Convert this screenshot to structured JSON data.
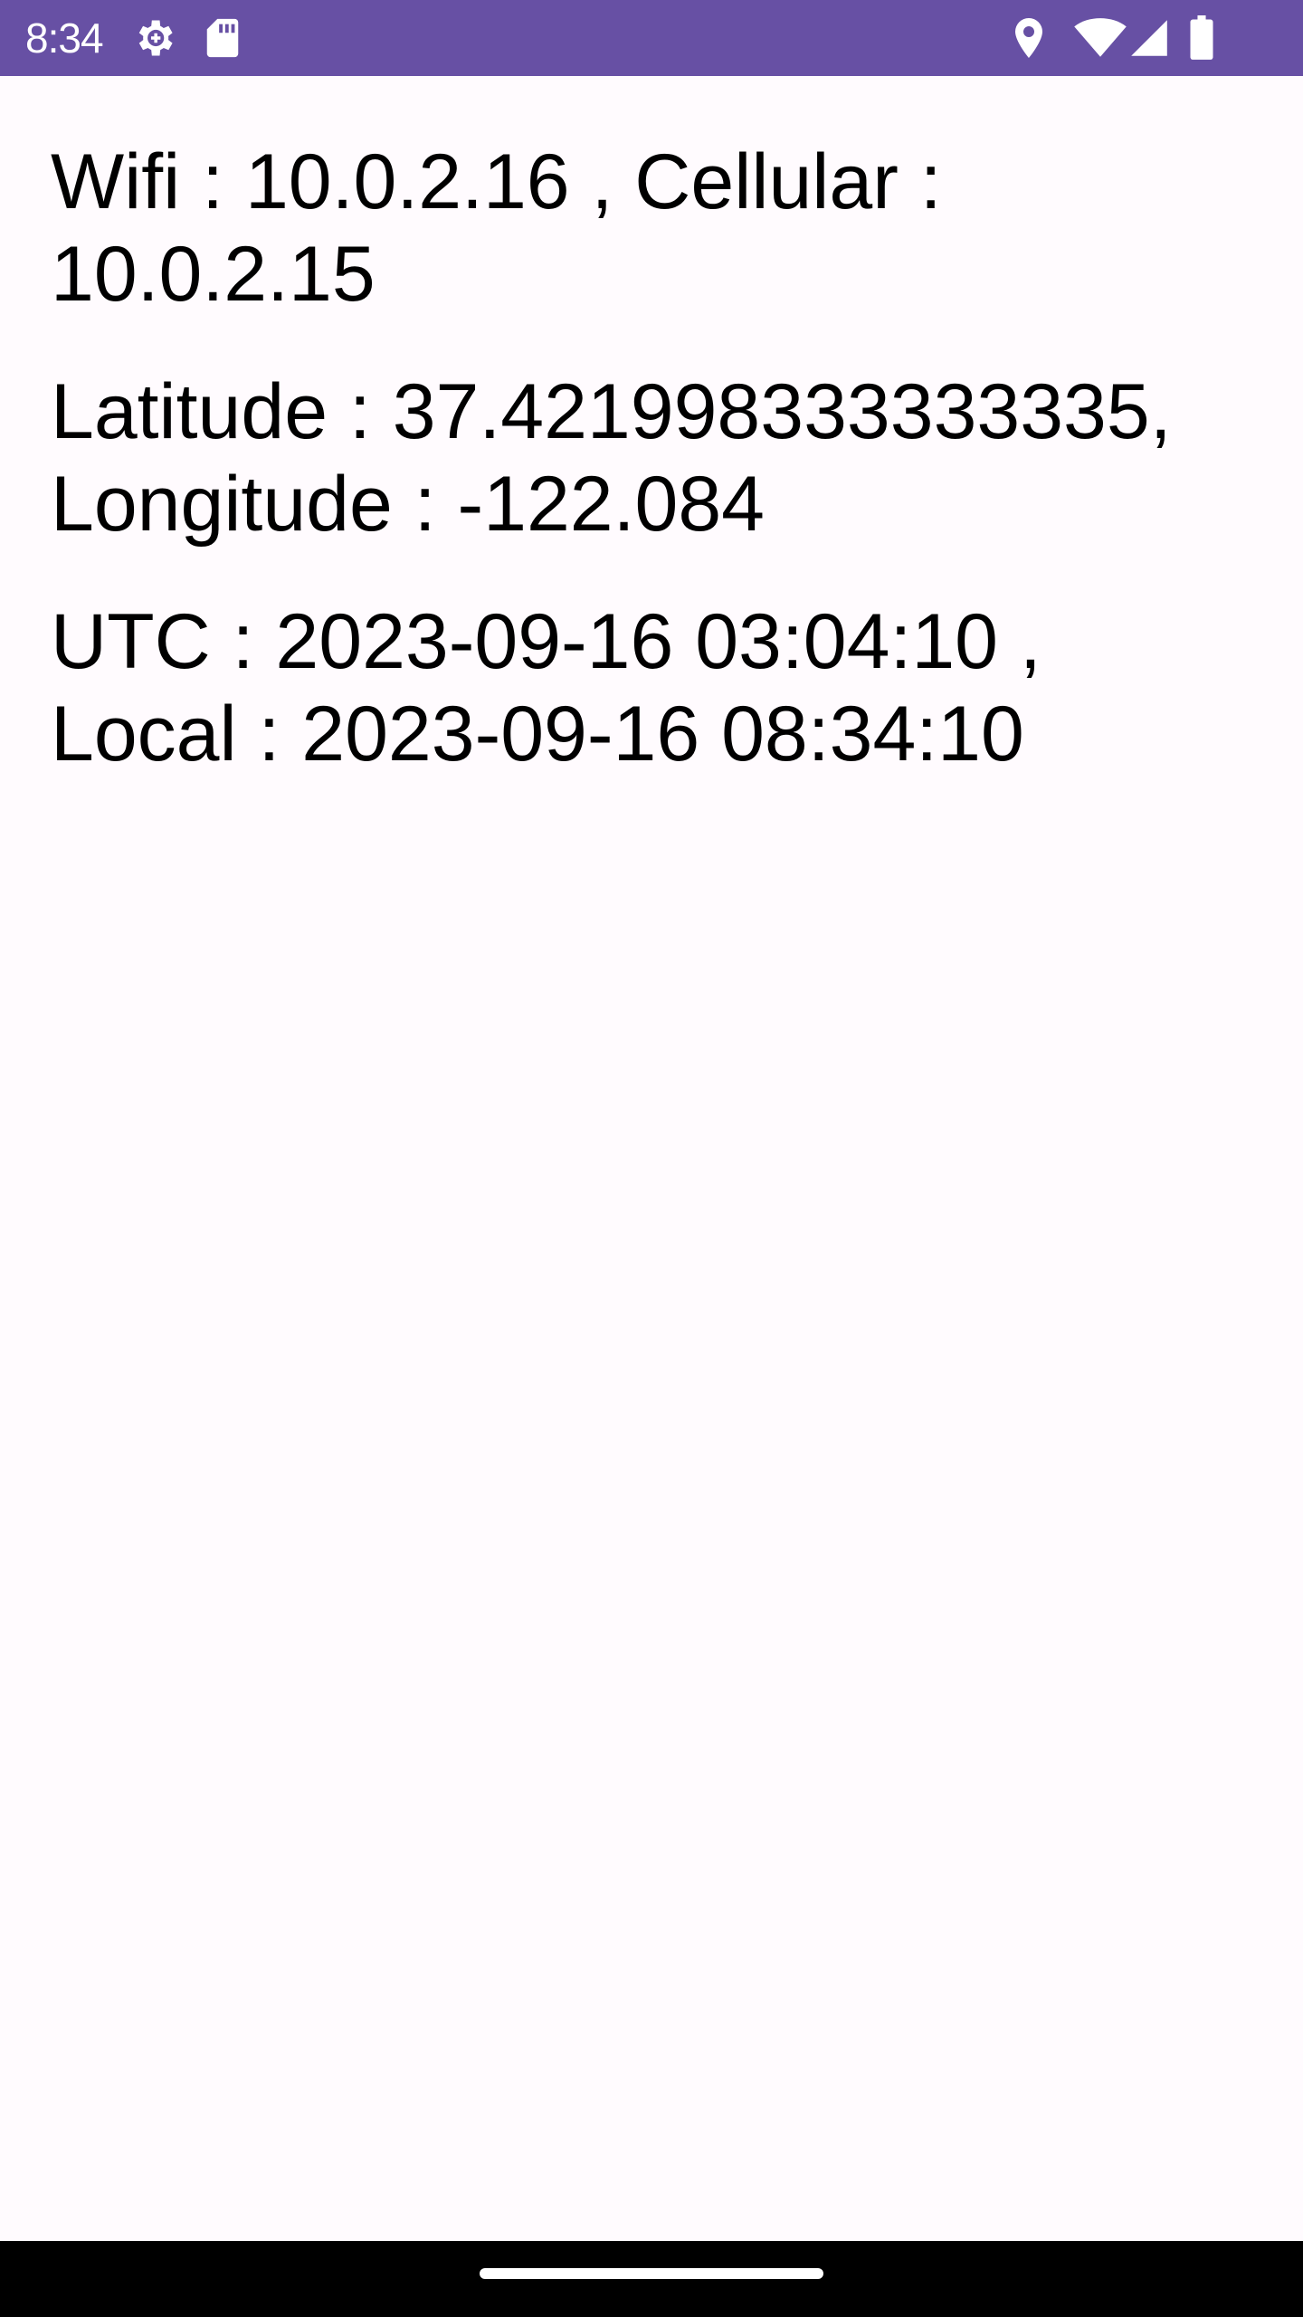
{
  "status_bar": {
    "time": "8:34",
    "bg_color": "#6750A4",
    "icons_left": [
      "settings-gear-icon",
      "sd-card-icon"
    ],
    "icons_right": [
      "location-pin-icon",
      "wifi-icon",
      "cellular-signal-icon",
      "battery-icon"
    ]
  },
  "main": {
    "network_line1": "Wifi : 10.0.2.16 , Cellular :",
    "network_line2": "10.0.2.15",
    "location_line1": "Latitude : 37.421998333333335,",
    "location_line2": "Longitude : -122.084",
    "time_line1": "UTC : 2023-09-16 03:04:10 ,",
    "time_line2": "Local : 2023-09-16 08:34:10"
  },
  "colors": {
    "background": "#FFFBFE",
    "text": "#000000",
    "nav_bar": "#000000"
  }
}
